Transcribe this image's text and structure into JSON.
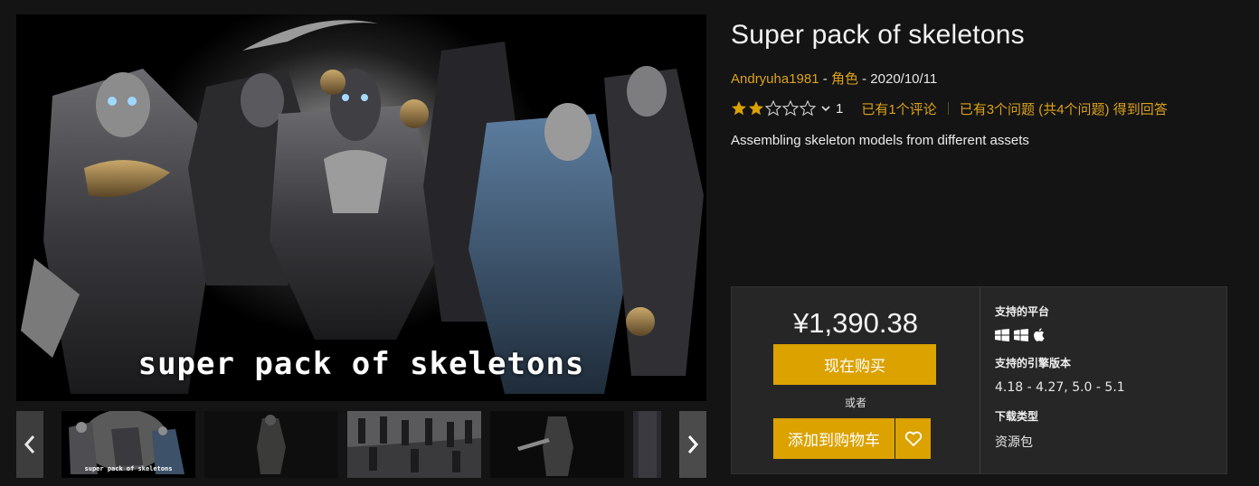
{
  "product": {
    "title": "Super pack of skeletons",
    "author": "Andryuha1981",
    "meta_sep1": " - ",
    "category": "角色",
    "meta_sep2": " - ",
    "date": "2020/10/11",
    "rating_value": 2,
    "rating_max": 5,
    "rating_count": "1",
    "reviews_link": "已有1个评论",
    "questions_link": "已有3个问题 (共4个问题) 得到回答",
    "description": "Assembling skeleton models from different assets"
  },
  "gallery": {
    "hero_caption": "super pack of skeletons",
    "thumb_caption": "super pack of skeletons",
    "thumbs": [
      "skeletons-group",
      "skeleton-single",
      "skeletons-lineup",
      "skeleton-sword",
      "skeleton-partial"
    ],
    "active_index": 0
  },
  "purchase": {
    "price": "¥1,390.38",
    "buy_label": "现在购买",
    "or_label": "或者",
    "cart_label": "添加到购物车"
  },
  "specs": {
    "platforms_heading": "支持的平台",
    "platforms": [
      "windows-icon",
      "windows-icon",
      "apple-icon"
    ],
    "engine_heading": "支持的引擎版本",
    "engine_versions": "4.18 - 4.27, 5.0 - 5.1",
    "download_heading": "下载类型",
    "download_type": "资源包"
  },
  "colors": {
    "accent": "#dba200",
    "link": "#dba21a",
    "background": "#141414",
    "panel": "#262626"
  }
}
